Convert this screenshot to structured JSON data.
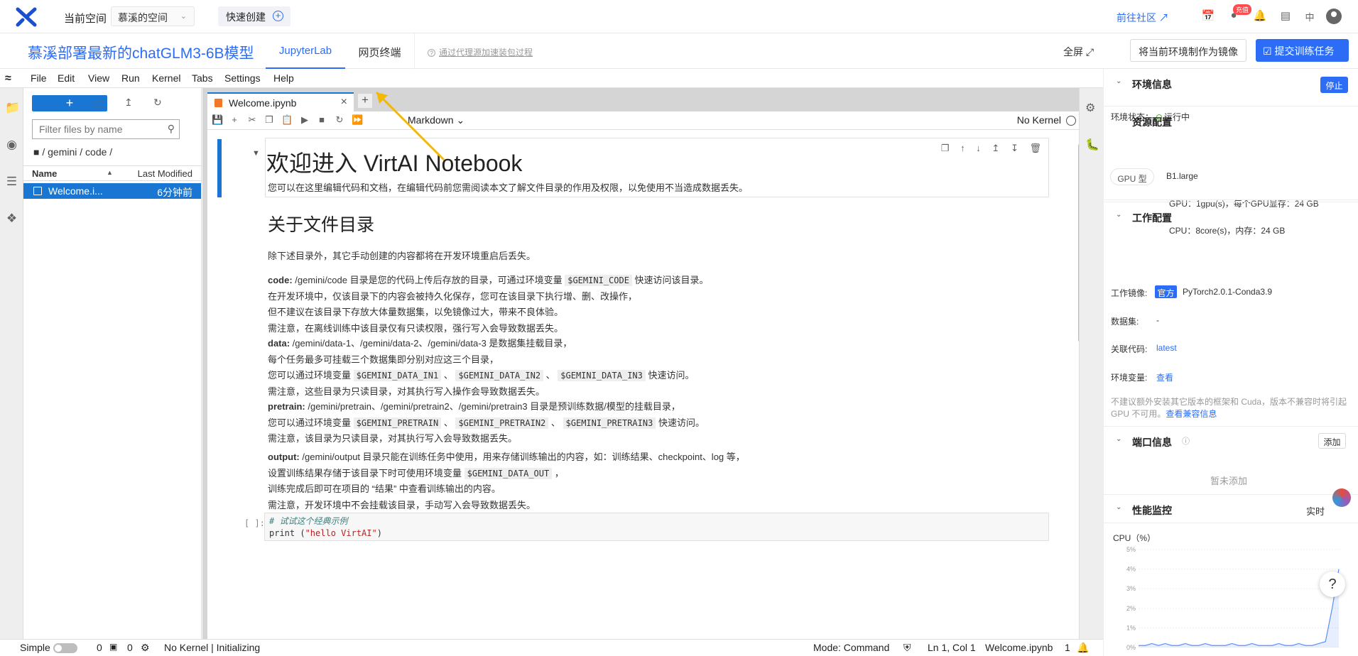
{
  "topbar": {
    "space_label": "当前空间",
    "space_value": "慕溪的空间",
    "quick_create": "快速创建",
    "community": "前往社区",
    "recharge_badge": "充值",
    "lang": "中"
  },
  "projectbar": {
    "title": "慕溪部署最新的chatGLM3-6B模型",
    "tab_jupyter": "JupyterLab",
    "tab_terminal": "网页终端",
    "proxy_link": "通过代理源加速装包过程",
    "fullscreen": "全屏",
    "mirror_button": "将当前环境制作为镜像",
    "submit_button": "提交训练任务"
  },
  "menu": [
    "File",
    "Edit",
    "View",
    "Run",
    "Kernel",
    "Tabs",
    "Settings",
    "Help"
  ],
  "filebrowser": {
    "new_label": "+",
    "filter_placeholder": "Filter files by name",
    "breadcrumb": "/ gemini / code /",
    "col_name": "Name",
    "col_modified": "Last Modified",
    "files": [
      {
        "name": "Welcome.i...",
        "modified": "6分钟前"
      }
    ]
  },
  "notebook": {
    "tab_name": "Welcome.ipynb",
    "cell_type": "Markdown",
    "kernel": "No Kernel",
    "h1": "欢迎进入 VirtAI Notebook",
    "intro": "您可以在这里编辑代码和文档，在编辑代码前您需阅读本文了解文件目录的作用及权限，以免使用不当造成数据丢失。",
    "h2": "关于文件目录",
    "p0": "除下述目录外，其它手动创建的内容都将在开发环境重启后丢失。",
    "code_label": "code:",
    "code_l1a": " /gemini/code 目录是您的代码上传后存放的目录，可通过环境变量 ",
    "code_var": "$GEMINI_CODE",
    "code_l1b": " 快速访问该目录。",
    "code_l2": "在开发环境中，仅该目录下的内容会被持久化保存，您可在该目录下执行增、删、改操作，",
    "code_l3": "但不建议在该目录下存放大体量数据集，以免镜像过大，带来不良体验。",
    "code_l4": "需注意，在离线训练中该目录仅有只读权限，强行写入会导致数据丢失。",
    "data_label": "data:",
    "data_l1": " /gemini/data-1、/gemini/data-2、/gemini/data-3 是数据集挂载目录，",
    "data_l2": "每个任务最多可挂载三个数据集即分别对应这三个目录，",
    "data_l3a": "您可以通过环境变量 ",
    "data_v1": "$GEMINI_DATA_IN1",
    "data_sep1": " 、 ",
    "data_v2": "$GEMINI_DATA_IN2",
    "data_sep2": " 、 ",
    "data_v3": "$GEMINI_DATA_IN3",
    "data_l3b": " 快速访问。",
    "data_l4": "需注意，这些目录为只读目录，对其执行写入操作会导致数据丢失。",
    "pre_label": "pretrain:",
    "pre_l1": " /gemini/pretrain、/gemini/pretrain2、/gemini/pretrain3 目录是预训练数据/模型的挂载目录，",
    "pre_l2a": "您可以通过环境变量 ",
    "pre_v1": "$GEMINI_PRETRAIN",
    "pre_sep1": " 、 ",
    "pre_v2": "$GEMINI_PRETRAIN2",
    "pre_sep2": " 、 ",
    "pre_v3": "$GEMINI_PRETRAIN3",
    "pre_l2b": " 快速访问。",
    "pre_l3": "需注意，该目录为只读目录，对其执行写入会导致数据丢失。",
    "out_label": "output:",
    "out_l1": " /gemini/output 目录只能在训练任务中使用，用来存储训练输出的内容，如：训练结果、checkpoint、log 等，",
    "out_l2a": "设置训练结果存储于该目录下时可使用环境变量 ",
    "out_var": "$GEMINI_DATA_OUT",
    "out_l2b": " ，",
    "out_l3": "训练完成后即可在项目的 “结果” 中查看训练输出的内容。",
    "out_l4": "需注意，开发环境中不会挂载该目录，手动写入会导致数据丢失。",
    "prompt": "[ ]:",
    "code_comment": "# 试试这个经典示例",
    "code_print": "print (",
    "code_string": "\"hello VirtAI\"",
    "code_close": ")"
  },
  "statusbar": {
    "mode_simple": "Simple",
    "zero1": "0",
    "zero2": "0",
    "kernel_status": "No Kernel | Initializing",
    "mode": "Mode: Command",
    "position": "Ln 1, Col 1",
    "filename": "Welcome.ipynb",
    "count": "1"
  },
  "side": {
    "env_title": "环境信息",
    "stop": "停止",
    "env_status_label": "环境状态：",
    "env_status_value": "运行中",
    "res_title": "资源配置",
    "gpu_type_label": "GPU 型",
    "gpu_type_value": "B1.large",
    "gpu_detail": "GPU：1gpu(s)，每个GPU显存：24 GB",
    "cpu_detail": "CPU：8core(s)，内存：24 GB",
    "work_title": "工作配置",
    "image_label": "工作镜像:",
    "official_tag": "官方",
    "image_value": "PyTorch2.0.1-Conda3.9",
    "dataset_label": "数据集:",
    "dataset_value": "-",
    "code_label": "关联代码:",
    "code_value": "latest",
    "envvar_label": "环境变量:",
    "envvar_value": "查看",
    "warn_text": "不建议额外安装其它版本的框架和 Cuda，版本不兼容时将引起 GPU 不可用。",
    "warn_link": "查看兼容信息",
    "port_title": "端口信息",
    "add": "添加",
    "port_empty": "暂未添加",
    "perf_title": "性能监控",
    "perf_realtime": "实时",
    "cpu_chart_title": "CPU（%）"
  },
  "chart_data": {
    "type": "line",
    "title": "CPU（%）",
    "ylim": [
      0,
      5
    ],
    "yticks": [
      "5%",
      "4%",
      "3%",
      "2%",
      "1%",
      "0%"
    ],
    "series": [
      {
        "values": [
          0.1,
          0.1,
          0.2,
          0.1,
          0.2,
          0.1,
          0.1,
          0.2,
          0.1,
          0.1,
          0.2,
          0.1,
          0.1,
          0.1,
          0.2,
          0.1,
          0.1,
          0.2,
          0.1,
          0.1,
          0.1,
          0.2,
          0.1,
          0.1,
          0.2,
          0.1,
          0.1,
          0.2,
          0.3,
          2.0,
          4.0
        ]
      }
    ],
    "color": "#5b8ff9"
  }
}
